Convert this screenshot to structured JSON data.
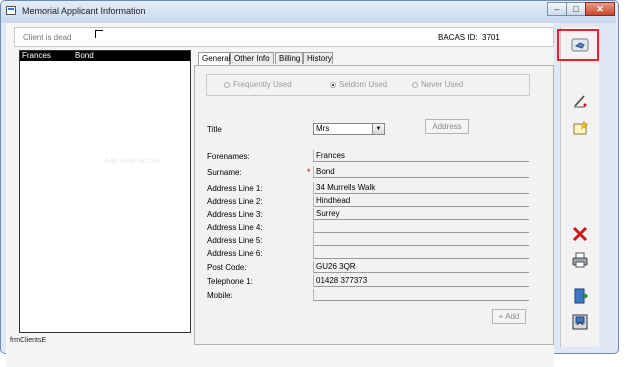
{
  "window": {
    "title": "Memorial Applicant Information",
    "controls": {
      "minimize": "–",
      "maximize": "□",
      "close": "✕"
    }
  },
  "header": {
    "client_dead_label": "Client is dead",
    "bacas_label": "BACAS ID:",
    "bacas_id": "3701"
  },
  "list": {
    "rows": [
      {
        "first": "Frances",
        "last": "Bond"
      }
    ],
    "ghost_text": "Add new record"
  },
  "form_name": "frmClientsE",
  "tabs": [
    {
      "label": "General",
      "active": true
    },
    {
      "label": "Other Info",
      "active": false
    },
    {
      "label": "Billing",
      "active": false
    },
    {
      "label": "History",
      "active": false
    }
  ],
  "usage": {
    "options": [
      "Frequently Used",
      "Seldom Used",
      "Never Used"
    ],
    "selected": "Seldom Used"
  },
  "form": {
    "title_label": "Title",
    "title_value": "Mrs",
    "address_button": "Address",
    "fields": [
      {
        "label": "Forenames:",
        "value": "Frances"
      },
      {
        "label": "Surname:",
        "value": "Bond",
        "required": true
      },
      {
        "label": "Address Line 1:",
        "value": "34 Murrells Walk"
      },
      {
        "label": "Address Line 2:",
        "value": "Hindhead"
      },
      {
        "label": "Address Line 3:",
        "value": "Surrey"
      },
      {
        "label": "Address Line 4:",
        "value": ""
      },
      {
        "label": "Address Line 5:",
        "value": ""
      },
      {
        "label": "Address Line 6:",
        "value": ""
      },
      {
        "label": "Post Code:",
        "value": "GU26 3QR"
      },
      {
        "label": "Telephone 1:",
        "value": "01428 377373"
      },
      {
        "label": "Mobile:",
        "value": ""
      }
    ],
    "add_button": "+ Add",
    "required_marker": "*"
  },
  "sidebar": {
    "icons": [
      "search-hand-icon",
      "edit-pencil-icon",
      "new-record-icon",
      "delete-x-icon",
      "print-icon",
      "exit-door-icon",
      "save-icon"
    ]
  },
  "colors": {
    "highlight": "#e0262a",
    "delete": "#cc1a1a",
    "accent": "#3c78c8"
  }
}
